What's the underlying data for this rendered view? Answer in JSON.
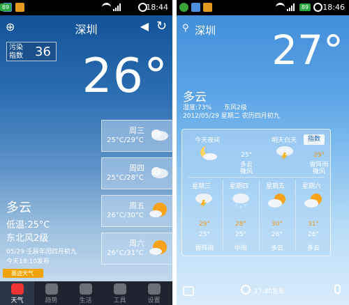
{
  "left": {
    "status_time": "18:44",
    "battery": "89",
    "city": "深圳",
    "aqi_label": "污染指数",
    "aqi_value": "36",
    "temp": "26°",
    "forecast": [
      {
        "day": "周三",
        "range": "25°C/29°C",
        "icon": "cloud-icon"
      },
      {
        "day": "周四",
        "range": "25°C/28°C",
        "icon": "cloud-icon"
      },
      {
        "day": "周五",
        "range": "26°C/30°C",
        "icon": "sun-icon"
      },
      {
        "day": "周六",
        "range": "26°C/31°C",
        "icon": "sun-icon"
      }
    ],
    "condition": "多云",
    "low": "低温:25°C",
    "wind": "东北风2级",
    "date": "05/29 壬辰年闰四月初九",
    "published": "今天18:10发布",
    "brand": "墨迹天气",
    "tabs": [
      "天气",
      "趋势",
      "生活",
      "工具",
      "设置"
    ]
  },
  "right": {
    "status_time": "18:46",
    "battery": "89",
    "city": "深圳",
    "temp": "27°",
    "condition": "多云",
    "humidity": "湿度:73%",
    "wind": "东风2级",
    "date": "2012/05/29 星期二 农历四月初九",
    "tonight": {
      "label": "今天夜间",
      "temp": "25°",
      "cond": "多云",
      "wind": "微风"
    },
    "tomorrow": {
      "label": "明天白天",
      "temp": "29°",
      "cond": "雷阵雨",
      "wind": "微风"
    },
    "index_label": "指数",
    "days": [
      {
        "label": "星期三",
        "high": "29°",
        "low": "25°",
        "cond": "雷阵雨"
      },
      {
        "label": "星期四",
        "high": "28°",
        "low": "25°",
        "cond": "中雨"
      },
      {
        "label": "星期五",
        "high": "30°",
        "low": "26°",
        "cond": "多云"
      },
      {
        "label": "星期六",
        "high": "31°",
        "low": "26°",
        "cond": "多云"
      }
    ],
    "published": "17:40发布"
  }
}
